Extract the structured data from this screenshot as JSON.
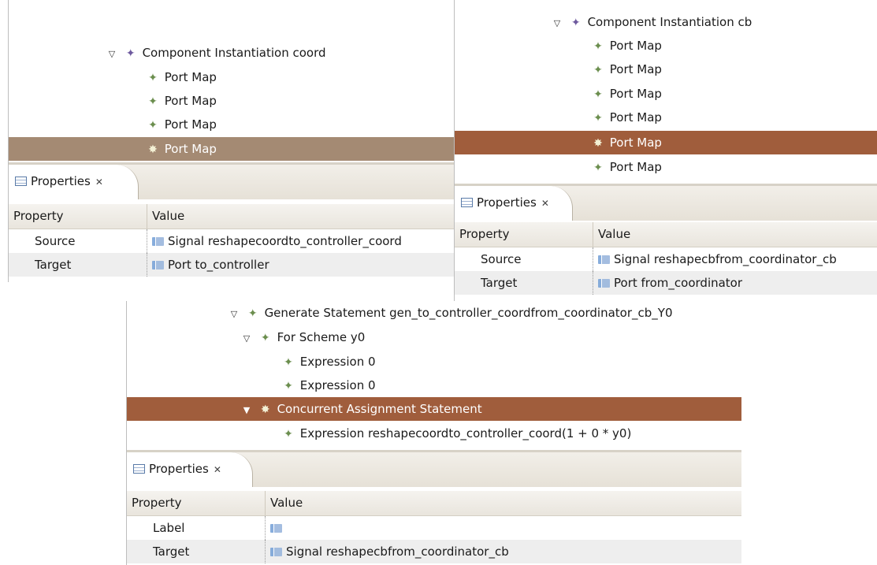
{
  "panel1": {
    "tree": [
      {
        "label": "Component Instantiation coord",
        "icon": "purple-diamond-icon",
        "twisty": "▽"
      },
      {
        "label": "Port Map",
        "icon": "green-diamond-icon"
      },
      {
        "label": "Port Map",
        "icon": "green-diamond-icon"
      },
      {
        "label": "Port Map",
        "icon": "green-diamond-icon"
      },
      {
        "label": "Port Map",
        "icon": "sparkle-icon",
        "selected": true
      }
    ],
    "props": {
      "tab": "Properties",
      "headers": [
        "Property",
        "Value"
      ],
      "rows": [
        {
          "property": "Source",
          "value": "Signal reshapecoordto_controller_coord"
        },
        {
          "property": "Target",
          "value": "Port to_controller"
        }
      ]
    }
  },
  "panel2": {
    "tree": [
      {
        "label": "Component Instantiation cb",
        "icon": "purple-diamond-icon",
        "twisty": "▽"
      },
      {
        "label": "Port Map",
        "icon": "green-diamond-icon"
      },
      {
        "label": "Port Map",
        "icon": "green-diamond-icon"
      },
      {
        "label": "Port Map",
        "icon": "green-diamond-icon"
      },
      {
        "label": "Port Map",
        "icon": "green-diamond-icon"
      },
      {
        "label": "Port Map",
        "icon": "sparkle-icon",
        "selected": true
      },
      {
        "label": "Port Map",
        "icon": "green-diamond-icon"
      }
    ],
    "props": {
      "tab": "Properties",
      "headers": [
        "Property",
        "Value"
      ],
      "rows": [
        {
          "property": "Source",
          "value": "Signal reshapecbfrom_coordinator_cb"
        },
        {
          "property": "Target",
          "value": "Port from_coordinator"
        }
      ]
    }
  },
  "panel3": {
    "tree": [
      {
        "label": "Generate Statement gen_to_controller_coordfrom_coordinator_cb_Y0",
        "icon": "green-diamond-icon",
        "twisty": "▽"
      },
      {
        "label": "For Scheme y0",
        "icon": "green-diamond-icon",
        "twisty": "▽"
      },
      {
        "label": "Expression 0",
        "icon": "green-diamond-icon"
      },
      {
        "label": "Expression 0",
        "icon": "green-diamond-icon"
      },
      {
        "label": "Concurrent Assignment Statement",
        "icon": "sparkle-icon",
        "twisty": "▼",
        "selected": true
      },
      {
        "label": "Expression reshapecoordto_controller_coord(1 + 0 * y0)",
        "icon": "green-diamond-icon"
      }
    ],
    "props": {
      "tab": "Properties",
      "headers": [
        "Property",
        "Value"
      ],
      "rows": [
        {
          "property": "Label",
          "value": ""
        },
        {
          "property": "Target",
          "value": "Signal reshapecbfrom_coordinator_cb"
        }
      ]
    }
  },
  "colors": {
    "selection_panel1": "#a48a73",
    "selection_panel2": "#a05d3c",
    "selection_panel3": "#a05d3c",
    "purple_icon": "#6e5a9e",
    "green_icon": "#6b8e4e"
  }
}
